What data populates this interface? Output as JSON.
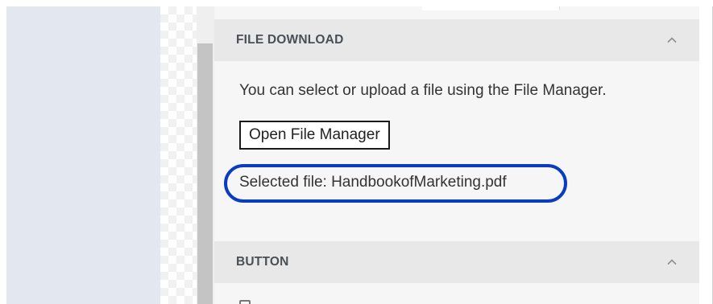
{
  "sections": {
    "file_download": {
      "title": "FILE DOWNLOAD",
      "info_text": "You can select or upload a file using the File Manager.",
      "open_button_label": "Open File Manager",
      "selected_file_text": "Selected file: HandbookofMarketing.pdf",
      "collapse_icon": "chevron-up-icon"
    },
    "button": {
      "title": "BUTTON",
      "collapse_icon": "chevron-up-icon"
    }
  },
  "colors": {
    "highlight_ring": "#0a3cc0",
    "header_bg": "#e8e8e8",
    "panel_bg": "#f6f6f6",
    "left_pane_bg": "#e3e7ef"
  }
}
